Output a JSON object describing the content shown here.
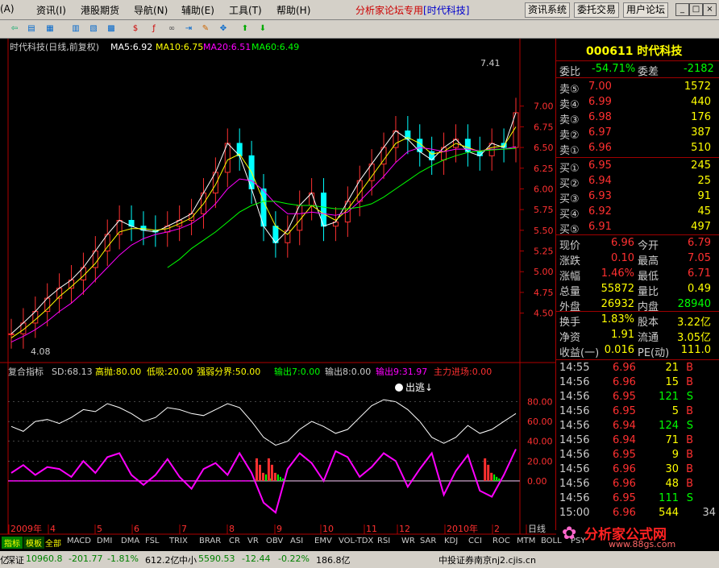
{
  "menu": {
    "items": [
      "(A)",
      "资讯(I)",
      "港股期货",
      "导航(N)",
      "辅助(E)",
      "工具(T)",
      "帮助(H)"
    ],
    "brand_prefix": "分析家论坛专用",
    "brand_name": "[时代科技]",
    "buttons": [
      "资讯系统",
      "委托交易",
      "用户论坛"
    ],
    "win_min": "_",
    "win_max": "□",
    "win_close": "×"
  },
  "chart_header": {
    "title": "时代科技(日线,前复权)",
    "ma5": "MA5:6.92",
    "ma10": "MA10:6.75",
    "ma20": "MA20:6.51",
    "ma60": "MA60:6.49",
    "high_mark": "7.41",
    "low_mark": "4.08"
  },
  "indicator_header": {
    "name": "复合指标",
    "sd": "SD:68.13",
    "high": "高抛:80.00",
    "low": "低吸:20.00",
    "mid": "强弱分界:50.00",
    "out1": "输出7:0.00",
    "out2": "输出8:0.00",
    "out3": "输出9:31.97",
    "main": "主力进场:0.00",
    "mark": "出逃↓"
  },
  "colors": {
    "up": "#ff3030",
    "down": "#00ffff",
    "ma5": "#ffffff",
    "ma10": "#ffff00",
    "ma20": "#ff00ff",
    "ma60": "#00ff00",
    "axis": "#b00000",
    "text_red": "#ff3030"
  },
  "chart_data": [
    {
      "type": "line",
      "title": "时代科技(日线,前复权)",
      "ylim": [
        4.0,
        7.6
      ],
      "y_ticks": [
        "7.00",
        "6.75",
        "6.50",
        "6.25",
        "6.00",
        "5.75",
        "5.50",
        "5.25",
        "5.00",
        "4.75",
        "4.50"
      ],
      "x_ticks": [
        "2009年",
        "4",
        "5",
        "6",
        "7",
        "8",
        "9",
        "10",
        "11",
        "12",
        "2010年",
        "2",
        "日线"
      ],
      "series": [
        {
          "name": "MA5",
          "values": [
            4.25,
            4.38,
            4.52,
            4.68,
            4.8,
            4.9,
            5.05,
            5.25,
            5.45,
            5.62,
            5.55,
            5.5,
            5.48,
            5.55,
            5.62,
            5.7,
            5.95,
            6.2,
            6.55,
            6.4,
            6.0,
            5.55,
            5.35,
            5.5,
            5.8,
            5.95,
            5.55,
            5.6,
            5.85,
            6.1,
            6.3,
            6.5,
            6.7,
            6.6,
            6.45,
            6.35,
            6.5,
            6.6,
            6.45,
            6.4,
            6.55,
            6.5,
            6.92
          ]
        },
        {
          "name": "MA10",
          "values": [
            4.2,
            4.3,
            4.42,
            4.55,
            4.7,
            4.82,
            4.95,
            5.1,
            5.3,
            5.48,
            5.52,
            5.52,
            5.5,
            5.52,
            5.58,
            5.65,
            5.82,
            6.05,
            6.35,
            6.42,
            6.2,
            5.85,
            5.55,
            5.45,
            5.62,
            5.8,
            5.7,
            5.62,
            5.75,
            5.95,
            6.15,
            6.35,
            6.55,
            6.62,
            6.55,
            6.42,
            6.45,
            6.55,
            6.5,
            6.45,
            6.5,
            6.52,
            6.75
          ]
        },
        {
          "name": "MA20",
          "values": [
            4.15,
            4.22,
            4.3,
            4.4,
            4.52,
            4.62,
            4.75,
            4.9,
            5.05,
            5.2,
            5.32,
            5.4,
            5.45,
            5.48,
            5.52,
            5.58,
            5.68,
            5.82,
            6.0,
            6.12,
            6.1,
            5.98,
            5.82,
            5.7,
            5.7,
            5.72,
            5.7,
            5.68,
            5.72,
            5.85,
            6.0,
            6.15,
            6.32,
            6.45,
            6.5,
            6.48,
            6.45,
            6.48,
            6.48,
            6.46,
            6.48,
            6.48,
            6.51
          ]
        },
        {
          "name": "MA60",
          "values": [
            null,
            null,
            null,
            null,
            null,
            null,
            null,
            null,
            null,
            null,
            null,
            null,
            null,
            5.05,
            5.15,
            5.28,
            5.38,
            5.48,
            5.6,
            5.72,
            5.8,
            5.85,
            5.85,
            5.82,
            5.8,
            5.8,
            5.78,
            5.76,
            5.76,
            5.78,
            5.82,
            5.9,
            6.0,
            6.1,
            6.2,
            6.28,
            6.35,
            6.4,
            6.44,
            6.46,
            6.47,
            6.48,
            6.49
          ]
        }
      ]
    },
    {
      "type": "line",
      "title": "复合指标",
      "ylim": [
        -40,
        100
      ],
      "y_ticks": [
        "80.00",
        "60.00",
        "40.00",
        "20.00",
        "0.00"
      ],
      "series": [
        {
          "name": "SD",
          "values": [
            55,
            50,
            60,
            62,
            58,
            64,
            72,
            70,
            78,
            74,
            68,
            60,
            64,
            74,
            72,
            68,
            66,
            72,
            78,
            74,
            60,
            44,
            36,
            40,
            52,
            60,
            55,
            48,
            52,
            64,
            76,
            82,
            80,
            72,
            60,
            44,
            38,
            44,
            56,
            48,
            52,
            60,
            68
          ]
        },
        {
          "name": "输出9",
          "values": [
            8,
            16,
            6,
            14,
            12,
            4,
            20,
            8,
            24,
            28,
            6,
            -4,
            6,
            22,
            4,
            -8,
            12,
            18,
            6,
            28,
            8,
            -22,
            -32,
            12,
            28,
            18,
            0,
            30,
            24,
            4,
            14,
            28,
            20,
            -6,
            12,
            28,
            -14,
            10,
            26,
            -10,
            -16,
            6,
            32
          ]
        }
      ]
    }
  ],
  "quote": {
    "code_name": "000611 时代科技",
    "wei_bi_label": "委比",
    "wei_bi": "-54.71%",
    "wei_cha_label": "委差",
    "wei_cha": "-2182",
    "sells": [
      {
        "label": "卖⑤",
        "price": "7.00",
        "vol": "1572"
      },
      {
        "label": "卖④",
        "price": "6.99",
        "vol": "440"
      },
      {
        "label": "卖③",
        "price": "6.98",
        "vol": "176"
      },
      {
        "label": "卖②",
        "price": "6.97",
        "vol": "387"
      },
      {
        "label": "卖①",
        "price": "6.96",
        "vol": "510"
      }
    ],
    "buys": [
      {
        "label": "买①",
        "price": "6.95",
        "vol": "245"
      },
      {
        "label": "买②",
        "price": "6.94",
        "vol": "25"
      },
      {
        "label": "买③",
        "price": "6.93",
        "vol": "91"
      },
      {
        "label": "买④",
        "price": "6.92",
        "vol": "45"
      },
      {
        "label": "买⑤",
        "price": "6.91",
        "vol": "497"
      }
    ],
    "stats": [
      {
        "l1": "现价",
        "v1": "6.96",
        "l2": "今开",
        "v2": "6.79"
      },
      {
        "l1": "涨跌",
        "v1": "0.10",
        "l2": "最高",
        "v2": "7.05"
      },
      {
        "l1": "涨幅",
        "v1": "1.46%",
        "l2": "最低",
        "v2": "6.71"
      },
      {
        "l1": "总量",
        "v1": "55872",
        "l2": "量比",
        "v2": "0.49"
      },
      {
        "l1": "外盘",
        "v1": "26932",
        "l2": "内盘",
        "v2": "28940"
      }
    ],
    "stats2": [
      {
        "l1": "换手",
        "v1": "1.83%",
        "l2": "股本",
        "v2": "3.22亿"
      },
      {
        "l1": "净资",
        "v1": "1.91",
        "l2": "流通",
        "v2": "3.05亿"
      },
      {
        "l1": "收益(一)",
        "v1": "0.016",
        "l2": "PE(动)",
        "v2": "111.0"
      }
    ],
    "ticks": [
      {
        "t": "14:55",
        "p": "6.96",
        "v": "21",
        "f": "B"
      },
      {
        "t": "14:56",
        "p": "6.96",
        "v": "15",
        "f": "B"
      },
      {
        "t": "14:56",
        "p": "6.95",
        "v": "121",
        "f": "S"
      },
      {
        "t": "14:56",
        "p": "6.95",
        "v": "5",
        "f": "B"
      },
      {
        "t": "14:56",
        "p": "6.94",
        "v": "124",
        "f": "S"
      },
      {
        "t": "14:56",
        "p": "6.94",
        "v": "71",
        "f": "B"
      },
      {
        "t": "14:56",
        "p": "6.95",
        "v": "9",
        "f": "B"
      },
      {
        "t": "14:56",
        "p": "6.96",
        "v": "30",
        "f": "B"
      },
      {
        "t": "14:56",
        "p": "6.96",
        "v": "48",
        "f": "B"
      },
      {
        "t": "14:56",
        "p": "6.95",
        "v": "111",
        "f": "S"
      },
      {
        "t": "15:00",
        "p": "6.96",
        "v": "544",
        "f": "34"
      }
    ]
  },
  "tabs": [
    "指标",
    "模板",
    "全部",
    "MACD",
    "DMI",
    "DMA",
    "FSL",
    "TRIX",
    "BRAR",
    "CR",
    "VR",
    "OBV",
    "ASI",
    "EMV",
    "VOL-TDX",
    "RSI",
    "WR",
    "SAR",
    "KDJ",
    "CCI",
    "ROC",
    "MTM",
    "BOLL",
    "PSY"
  ],
  "watermark": {
    "title": "分析家公式网",
    "url": "www.88gs.com"
  },
  "status": {
    "idx1_name": "深证",
    "idx1_val": "10960.8",
    "idx1_chg": "-201.77",
    "idx1_pct": "-1.81%",
    "idx1_amt": "612.2亿",
    "idx2_name": "中小",
    "idx2_val": "5590.53",
    "idx2_chg": "-12.44",
    "idx2_pct": "-0.22%",
    "idx2_amt": "186.8亿",
    "broker": "中投证券南京nj2.cjis.cn",
    "left_cut": "亿"
  }
}
